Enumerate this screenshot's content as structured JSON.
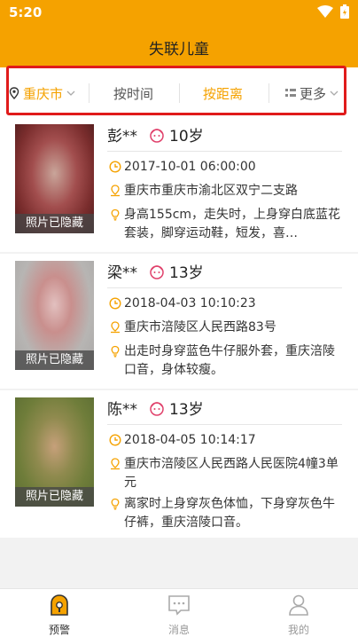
{
  "status_bar": {
    "time": "5:20"
  },
  "header": {
    "title": "失联儿童"
  },
  "filters": {
    "location": "重庆市",
    "by_time": "按时间",
    "by_distance": "按距离",
    "more": "更多"
  },
  "cards": [
    {
      "name": "彭**",
      "age": "10岁",
      "datetime": "2017-10-01 06:00:00",
      "address": "重庆市重庆市渝北区双宁二支路",
      "description": "身高155cm，走失时，上身穿白底蓝花套装，脚穿运动鞋，短发，喜…",
      "photo_caption": "照片已隐藏"
    },
    {
      "name": "梁**",
      "age": "13岁",
      "datetime": "2018-04-03 10:10:23",
      "address": "重庆市涪陵区人民西路83号",
      "description": "出走时身穿蓝色牛仔服外套，重庆涪陵口音，身体较瘦。",
      "photo_caption": "照片已隐藏"
    },
    {
      "name": "陈**",
      "age": "13岁",
      "datetime": "2018-04-05 10:14:17",
      "address": "重庆市涪陵区人民西路人民医院4幢3单元",
      "description": "离家时上身穿灰色体恤，下身穿灰色牛仔裤，重庆涪陵口音。",
      "photo_caption": "照片已隐藏"
    }
  ],
  "tab_bar": {
    "alert": "预警",
    "messages": "消息",
    "mine": "我的"
  },
  "colors": {
    "accent": "#f5a200",
    "highlight_box": "#e01b1b"
  }
}
